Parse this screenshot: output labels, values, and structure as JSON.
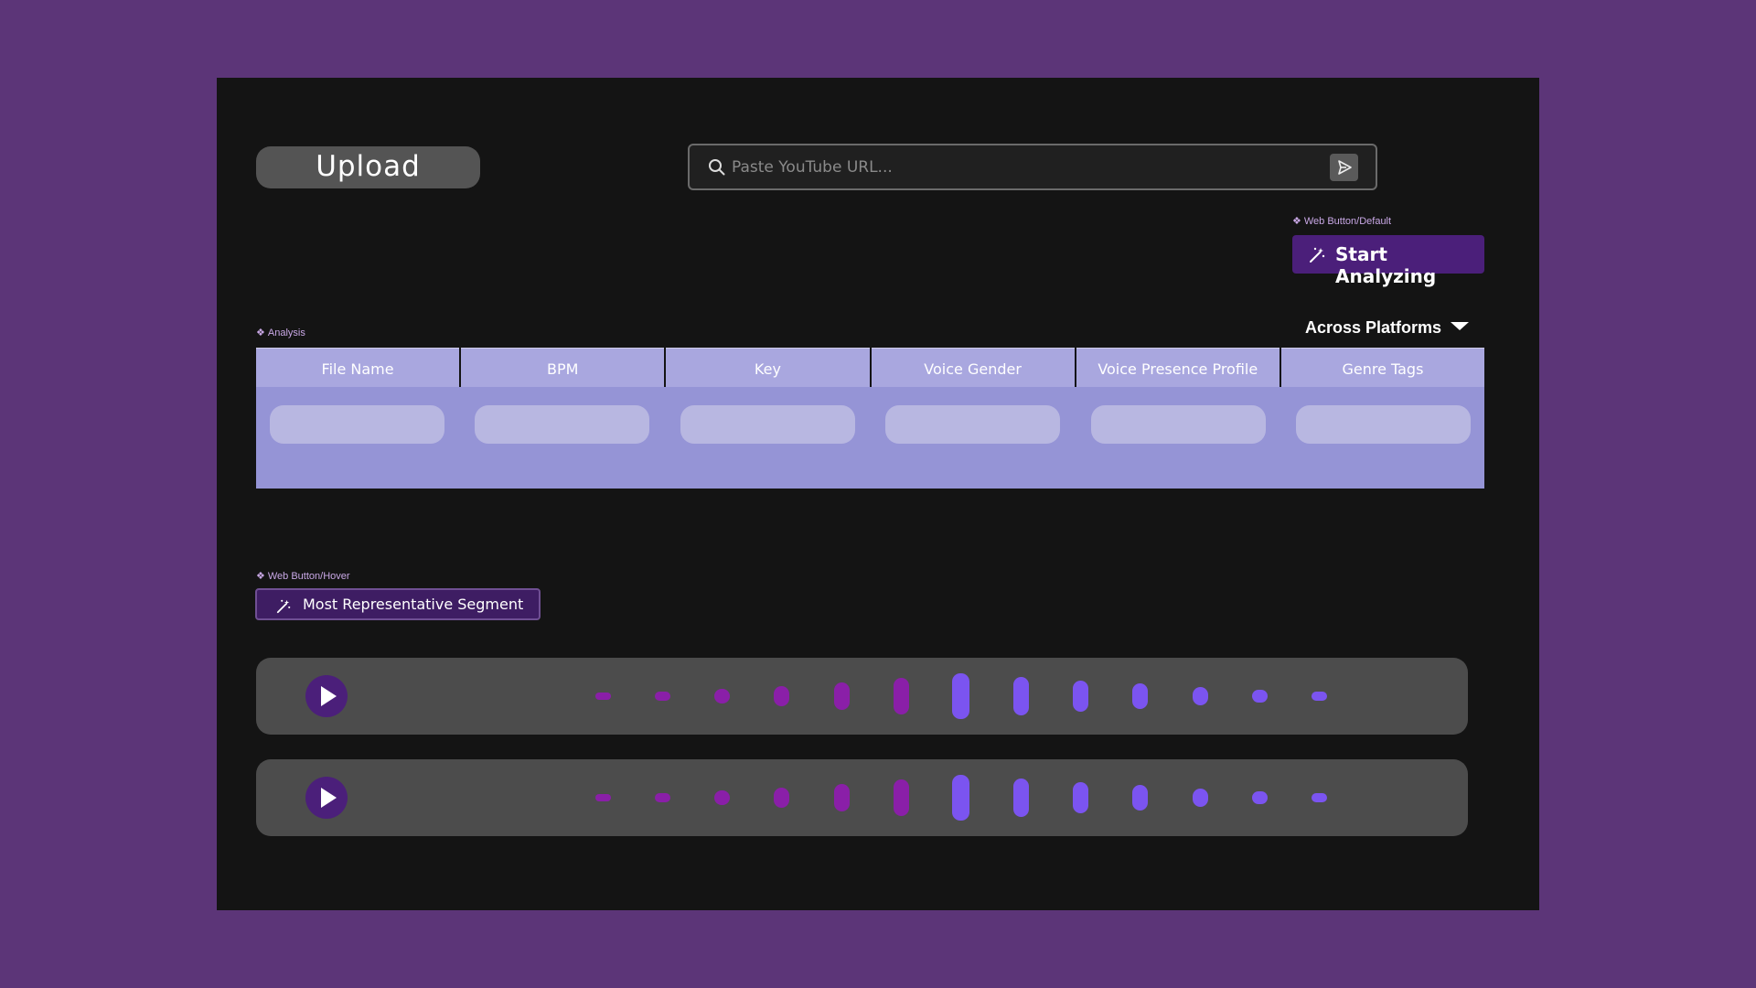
{
  "upload_button": {
    "label": "Upload"
  },
  "search": {
    "placeholder": "Paste YouTube URL..."
  },
  "start_component_label": "Web Button/Default",
  "start_button": {
    "label": "Start Analyzing"
  },
  "analysis_label": "Analysis",
  "platform_dropdown": {
    "selected": "Across Platforms"
  },
  "table": {
    "columns": [
      "File Name",
      "BPM",
      "Key",
      "Voice Gender",
      "Voice Presence Profile",
      "Genre Tags"
    ]
  },
  "segment_component_label": "Web Button/Hover",
  "segment_button": {
    "label": "Most Representative Segment"
  },
  "colors": {
    "background": "#5c3578",
    "frame": "#141414",
    "accent": "#4b1f7a",
    "table_header": "#a9a7df",
    "table_body": "#9594d6",
    "bar_magenta": "#8a1fa8",
    "bar_violet": "#7b54f0"
  },
  "players": [
    {
      "icon": "play-icon"
    },
    {
      "icon": "play-icon"
    }
  ]
}
